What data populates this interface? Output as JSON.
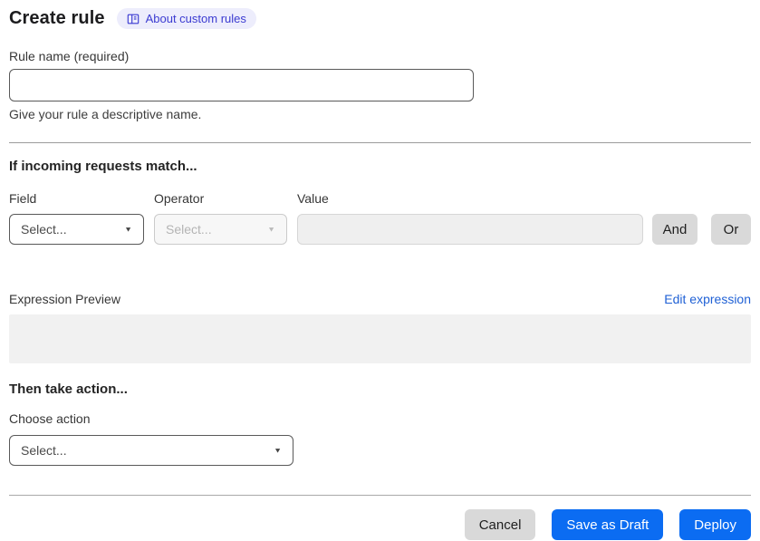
{
  "header": {
    "title": "Create rule",
    "badge_label": "About custom rules"
  },
  "icons": {
    "dropdown_caret": "▼",
    "badge_icon": "book-icon"
  },
  "rule_name": {
    "label": "Rule name (required)",
    "value": "",
    "placeholder": "",
    "helper": "Give your rule a descriptive name."
  },
  "match": {
    "heading": "If incoming requests match...",
    "field_label": "Field",
    "operator_label": "Operator",
    "value_label": "Value",
    "field_value": "Select...",
    "operator_value": "Select...",
    "value_value": "",
    "and_label": "And",
    "or_label": "Or"
  },
  "expression": {
    "label": "Expression Preview",
    "edit_link": "Edit expression",
    "value": ""
  },
  "action": {
    "heading": "Then take action...",
    "label": "Choose action",
    "select_value": "Select..."
  },
  "footer": {
    "cancel_label": "Cancel",
    "save_draft_label": "Save as Draft",
    "deploy_label": "Deploy"
  },
  "colors": {
    "primary_blue": "#0b6cf2",
    "link_blue": "#2061d5",
    "badge_bg": "#ededfc",
    "badge_text": "#3b3bd1",
    "neutral_button": "#d9d9d9",
    "preview_bg": "#f1f1f1"
  }
}
